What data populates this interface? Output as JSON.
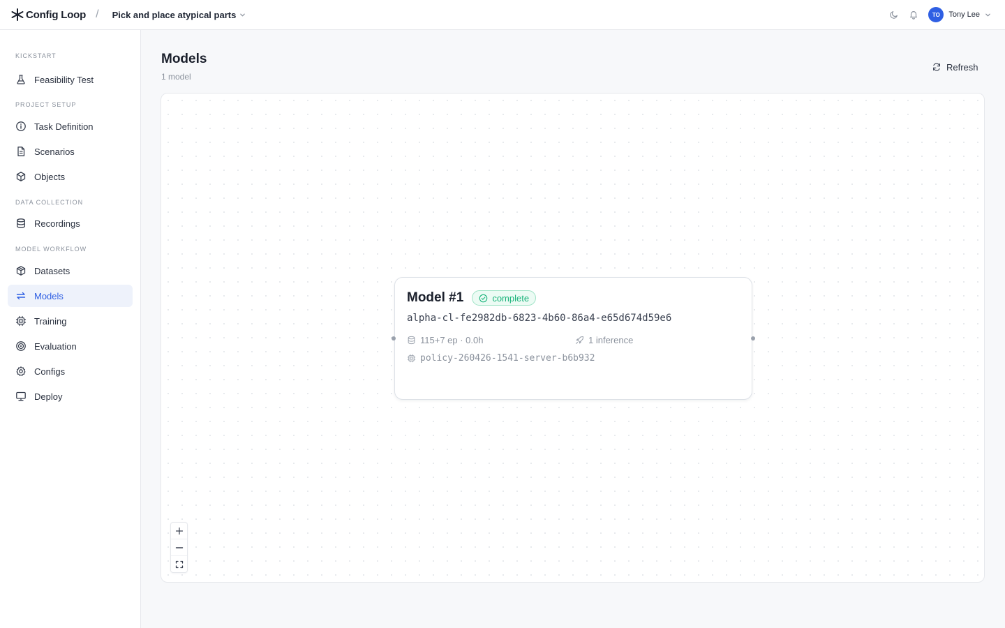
{
  "topbar": {
    "brand": "Config Loop",
    "separator": "/",
    "project": "Pick and place atypical parts",
    "user_initials": "TO",
    "user_name": "Tony Lee"
  },
  "sidebar": {
    "sections": [
      {
        "label": "KICKSTART",
        "items": [
          {
            "label": "Feasibility Test",
            "icon": "flask-icon"
          }
        ]
      },
      {
        "label": "PROJECT SETUP",
        "items": [
          {
            "label": "Task Definition",
            "icon": "info-icon"
          },
          {
            "label": "Scenarios",
            "icon": "document-icon"
          },
          {
            "label": "Objects",
            "icon": "cube-icon"
          }
        ]
      },
      {
        "label": "DATA COLLECTION",
        "items": [
          {
            "label": "Recordings",
            "icon": "database-icon"
          }
        ]
      },
      {
        "label": "MODEL WORKFLOW",
        "items": [
          {
            "label": "Datasets",
            "icon": "package-icon"
          },
          {
            "label": "Models",
            "icon": "arrows-exchange-icon",
            "active": true
          },
          {
            "label": "Training",
            "icon": "cpu-icon"
          },
          {
            "label": "Evaluation",
            "icon": "target-icon"
          },
          {
            "label": "Configs",
            "icon": "gear-icon"
          },
          {
            "label": "Deploy",
            "icon": "monitor-icon"
          }
        ]
      }
    ]
  },
  "main": {
    "title": "Models",
    "subtitle": "1 model",
    "refresh_label": "Refresh"
  },
  "model_card": {
    "title": "Model #1",
    "status": "complete",
    "id": "alpha-cl-fe2982db-6823-4b60-86a4-e65d674d59e6",
    "episodes": "115+7 ep · 0.0h",
    "inference": "1 inference",
    "policy": "policy-260426-1541-server-b6b932"
  },
  "colors": {
    "accent": "#2f5fe3",
    "success": "#19b37a",
    "active_bg": "#eef2fb"
  }
}
